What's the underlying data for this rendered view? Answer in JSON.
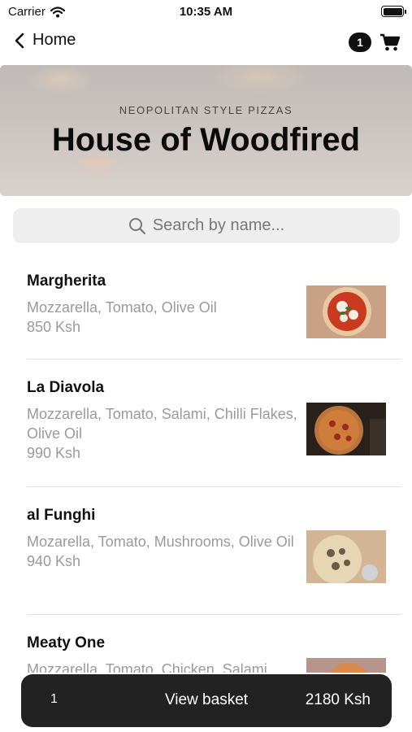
{
  "status": {
    "carrier": "Carrier",
    "time": "10:35 AM"
  },
  "nav": {
    "back_label": "Home",
    "cart_count": "1"
  },
  "hero": {
    "subtitle": "NEOPOLITAN STYLE PIZZAS",
    "title": "House of Woodfired"
  },
  "search": {
    "placeholder": "Search by name..."
  },
  "menu": {
    "items": [
      {
        "name": "Margherita",
        "description": "Mozzarella, Tomato, Olive Oil",
        "price": "850 Ksh"
      },
      {
        "name": "La Diavola",
        "description": "Mozzarella, Tomato, Salami, Chilli Flakes, Olive Oil",
        "price": "990 Ksh"
      },
      {
        "name": "al Funghi",
        "description": "Mozarella, Tomato, Mushrooms, Olive Oil",
        "price": "940 Ksh"
      },
      {
        "name": "Meaty One",
        "description": "Mozzarella, Tomato, Chicken, Salami",
        "price": ""
      }
    ]
  },
  "basket": {
    "quantity": "1",
    "label": "View basket",
    "total": "2180 Ksh"
  },
  "icons": {
    "wifi": "wifi-icon",
    "battery": "battery-icon",
    "back": "chevron-left-icon",
    "cart": "cart-icon",
    "search": "search-icon"
  },
  "colors": {
    "basket_bg": "#222222",
    "badge_bg": "#111111",
    "search_bg": "#eeeeef",
    "secondary_text": "#9a9a9d"
  }
}
